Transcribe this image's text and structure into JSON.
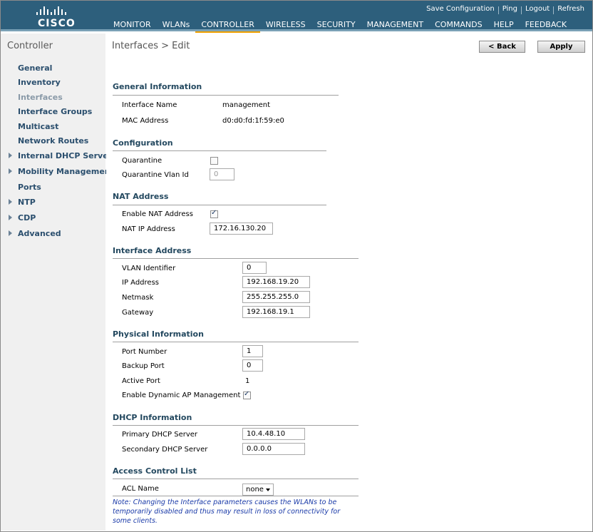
{
  "brand": {
    "logo_text": "CISCO"
  },
  "util_links": [
    "Save Configuration",
    "Ping",
    "Logout",
    "Refresh"
  ],
  "nav": [
    "MONITOR",
    "WLANs",
    "CONTROLLER",
    "WIRELESS",
    "SECURITY",
    "MANAGEMENT",
    "COMMANDS",
    "HELP",
    "FEEDBACK"
  ],
  "nav_active": "CONTROLLER",
  "sidebar": {
    "title": "Controller",
    "items": [
      {
        "label": "General",
        "expandable": false,
        "current": false
      },
      {
        "label": "Inventory",
        "expandable": false,
        "current": false
      },
      {
        "label": "Interfaces",
        "expandable": false,
        "current": true
      },
      {
        "label": "Interface Groups",
        "expandable": false,
        "current": false
      },
      {
        "label": "Multicast",
        "expandable": false,
        "current": false
      },
      {
        "label": "Network Routes",
        "expandable": false,
        "current": false
      },
      {
        "label": "Internal DHCP Server",
        "expandable": true,
        "current": false
      },
      {
        "label": "Mobility Management",
        "expandable": true,
        "current": false
      },
      {
        "label": "Ports",
        "expandable": false,
        "current": false
      },
      {
        "label": "NTP",
        "expandable": true,
        "current": false
      },
      {
        "label": "CDP",
        "expandable": true,
        "current": false
      },
      {
        "label": "Advanced",
        "expandable": true,
        "current": false
      }
    ]
  },
  "page": {
    "title": "Interfaces > Edit",
    "back_label": "< Back",
    "apply_label": "Apply"
  },
  "general": {
    "heading": "General Information",
    "interface_name_label": "Interface Name",
    "interface_name": "management",
    "mac_label": "MAC Address",
    "mac": "d0:d0:fd:1f:59:e0"
  },
  "configuration": {
    "heading": "Configuration",
    "quarantine_label": "Quarantine",
    "quarantine_checked": false,
    "quarantine_vlan_label": "Quarantine Vlan Id",
    "quarantine_vlan": "0"
  },
  "nat": {
    "heading": "NAT Address",
    "enable_label": "Enable NAT Address",
    "enable_checked": true,
    "ip_label": "NAT IP Address",
    "ip": "172.16.130.20"
  },
  "interface_address": {
    "heading": "Interface Address",
    "vlan_label": "VLAN Identifier",
    "vlan": "0",
    "ip_label": "IP Address",
    "ip": "192.168.19.20",
    "netmask_label": "Netmask",
    "netmask": "255.255.255.0",
    "gateway_label": "Gateway",
    "gateway": "192.168.19.1"
  },
  "physical": {
    "heading": "Physical Information",
    "port_label": "Port Number",
    "port": "1",
    "backup_label": "Backup Port",
    "backup": "0",
    "active_label": "Active Port",
    "active": "1",
    "dyn_ap_label": "Enable Dynamic AP Management",
    "dyn_ap_checked": true
  },
  "dhcp": {
    "heading": "DHCP Information",
    "primary_label": "Primary DHCP Server",
    "primary": "10.4.48.10",
    "secondary_label": "Secondary DHCP Server",
    "secondary": "0.0.0.0"
  },
  "acl": {
    "heading": "Access Control List",
    "name_label": "ACL Name",
    "name_value": "none"
  },
  "note": "Note: Changing the Interface parameters causes the WLANs to be temporarily disabled and thus may result in loss of connectivity for some clients.",
  "colors": {
    "header": "#2d5f7c",
    "accent": "#f0a000",
    "section_heading": "#23485f",
    "note": "#1a3aa8"
  }
}
